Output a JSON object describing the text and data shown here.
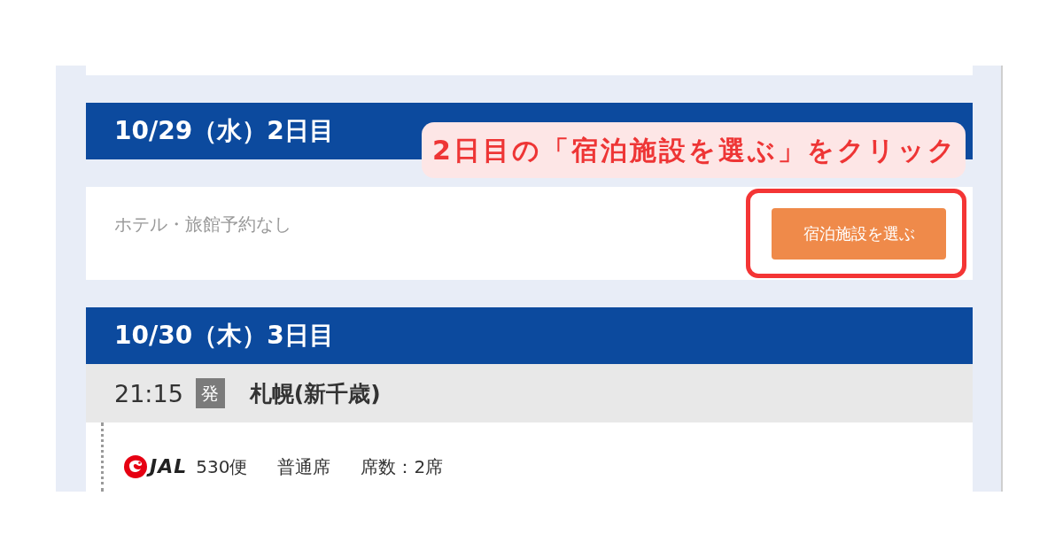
{
  "days": [
    {
      "header": "10/29（水）2日目",
      "callout": "2日目の「宿泊施設を選ぶ」をクリック",
      "accommodation": {
        "status": "ホテル・旅館予約なし",
        "button": {
          "label": "宿泊施設を選ぶ",
          "highlighted": true
        }
      }
    },
    {
      "header": "10/30（木）3日目",
      "departure": {
        "time": "21:15",
        "tag": "発",
        "place": "札幌(新千歳)"
      },
      "flight": {
        "airline": "JAL",
        "flight_number": "530便",
        "seat_class": "普通席",
        "seats": "席数：2席"
      }
    }
  ]
}
